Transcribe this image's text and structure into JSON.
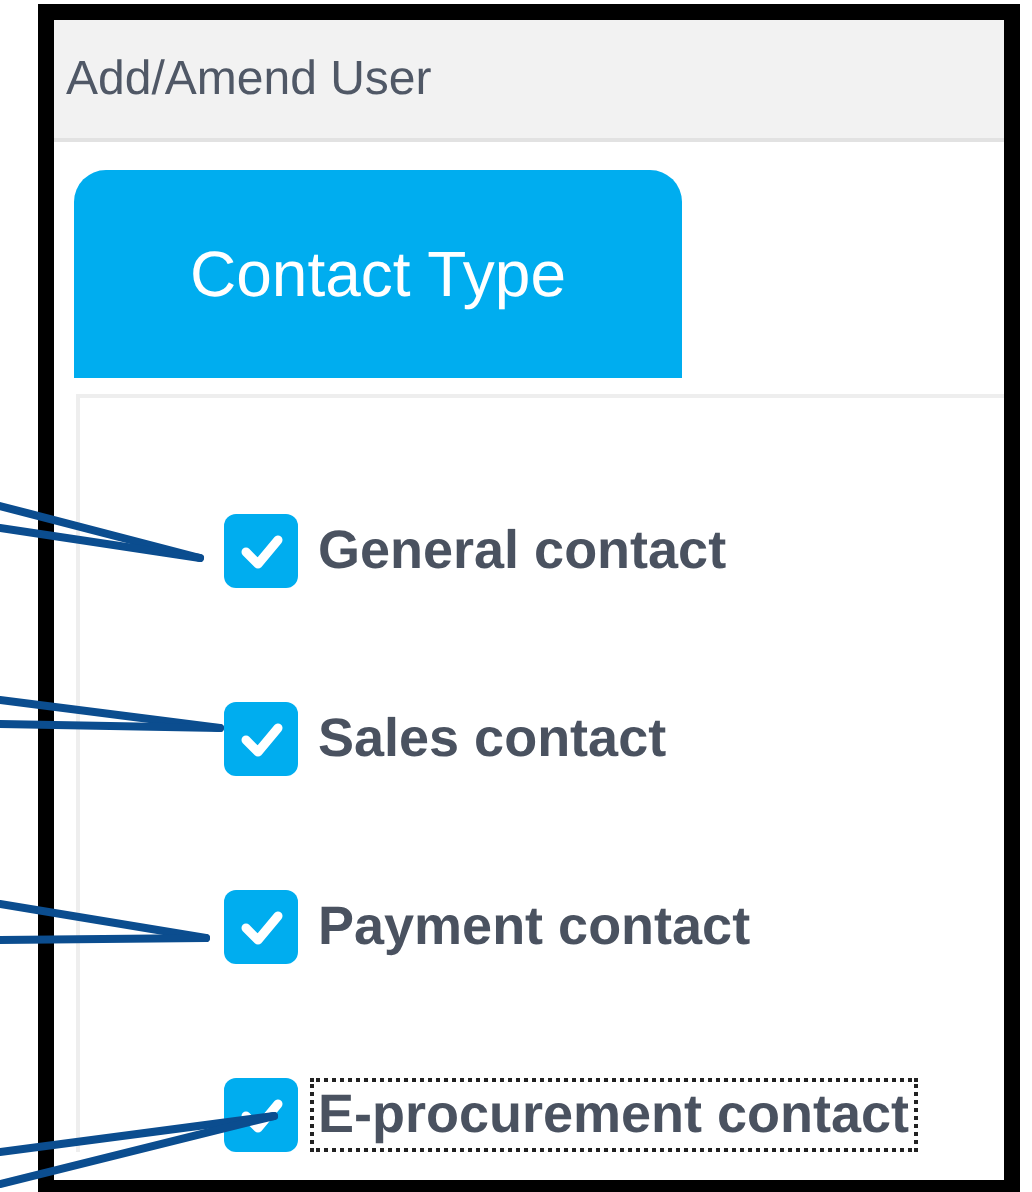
{
  "header": {
    "title": "Add/Amend User"
  },
  "tabs": [
    {
      "label": "Contact Type",
      "selected": true
    }
  ],
  "items": [
    {
      "label": "General contact",
      "checked": true,
      "focused": false
    },
    {
      "label": "Sales contact",
      "checked": true,
      "focused": false
    },
    {
      "label": "Payment contact",
      "checked": true,
      "focused": false
    },
    {
      "label": "E-procurement contact",
      "checked": true,
      "focused": true
    }
  ]
}
